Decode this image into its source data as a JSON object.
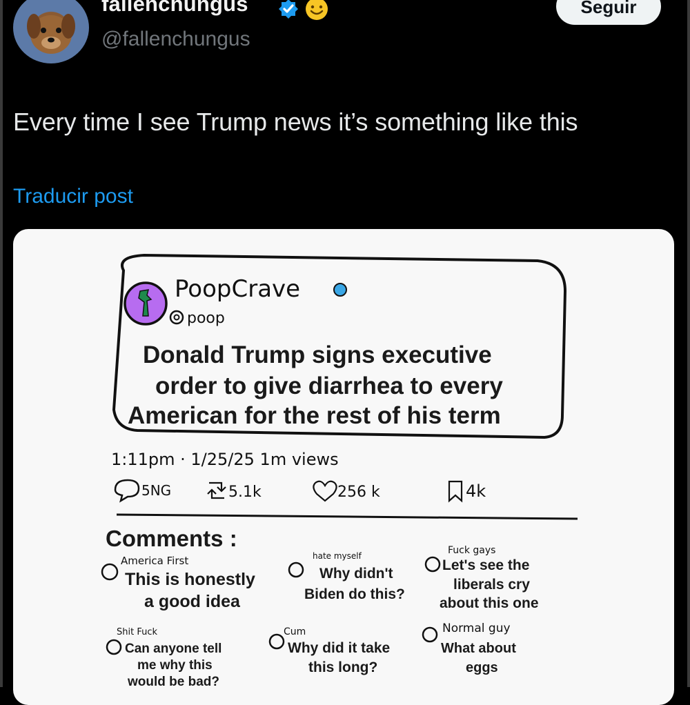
{
  "author": {
    "display_name": "fallenchungus",
    "handle": "@fallenchungus",
    "badge_color": "#1d9bf0"
  },
  "follow_button": {
    "label": "Seguir"
  },
  "post": {
    "text": "Every time I see Trump news it’s something like this",
    "translate_label": "Traducir post"
  },
  "image": {
    "account_name": "PoopCrave",
    "account_handle": "poop",
    "headline_line1": "Donald Trump signs executive",
    "headline_line2": "order to give diarrhea to every",
    "headline_line3": "American for the rest of his term",
    "timestamp": "1:11pm · 1/25/25  1m views",
    "stats": {
      "replies": "5NG",
      "reposts": "5.1k",
      "likes": "256 k",
      "bookmarks": "4k"
    },
    "comments_title": "Comments :",
    "comments": [
      {
        "user": "America First",
        "lines": [
          "This is honestly",
          "a good idea"
        ]
      },
      {
        "user": "hate myself",
        "lines": [
          "Why didn't",
          "Biden do this?"
        ]
      },
      {
        "user": "Fuck gays",
        "lines": [
          "Let's see the",
          "liberals cry",
          "about this one"
        ]
      },
      {
        "user": "Shit Fuck",
        "lines": [
          "Can anyone tell",
          "me why this",
          "would be bad?"
        ]
      },
      {
        "user": "Cum",
        "lines": [
          "Why did it take",
          "this long?"
        ]
      },
      {
        "user": "Normal guy",
        "lines": [
          "What about",
          "eggs"
        ]
      }
    ]
  }
}
